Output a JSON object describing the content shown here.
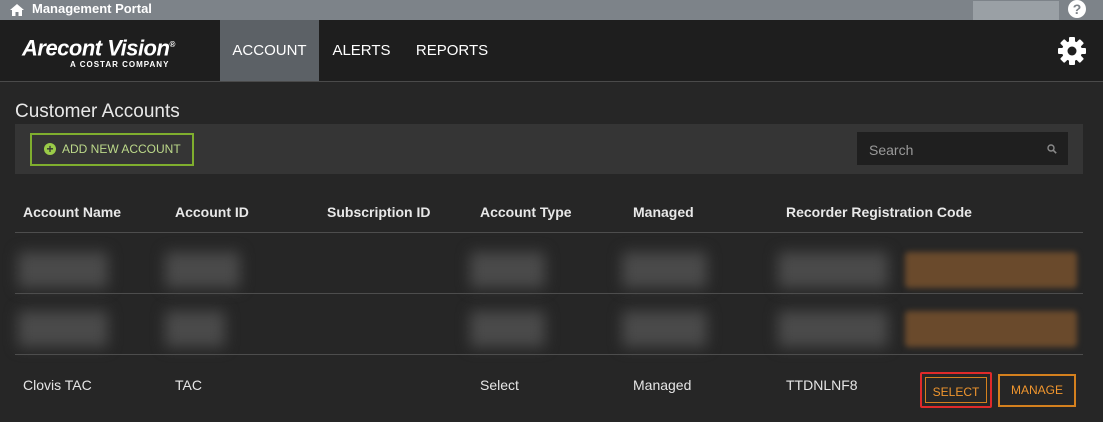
{
  "portal": {
    "title": "Management Portal",
    "help_label": "?"
  },
  "brand": {
    "name": "Arecont Vision",
    "registered": "®",
    "tagline": "A COSTAR COMPANY"
  },
  "nav": {
    "tabs": [
      {
        "label": "ACCOUNT",
        "active": true
      },
      {
        "label": "ALERTS",
        "active": false
      },
      {
        "label": "REPORTS",
        "active": false
      }
    ]
  },
  "page": {
    "title": "Customer Accounts"
  },
  "toolbar": {
    "add_label": "ADD NEW ACCOUNT",
    "search_placeholder": "Search"
  },
  "table": {
    "columns": [
      "Account Name",
      "Account ID",
      "Subscription ID",
      "Account Type",
      "Managed",
      "Recorder Registration Code"
    ],
    "rows": [
      {
        "name": "Clovis TAC",
        "id": "TAC",
        "subscription": "",
        "type": "Select",
        "managed": "Managed",
        "code": "TTDNLNF8",
        "select_label": "SELECT",
        "manage_label": "MANAGE"
      }
    ]
  },
  "colors": {
    "accent_green": "#7fae2e",
    "accent_orange": "#d4801e",
    "highlight_red": "#e02a2a",
    "active_tab": "#5c6166"
  }
}
